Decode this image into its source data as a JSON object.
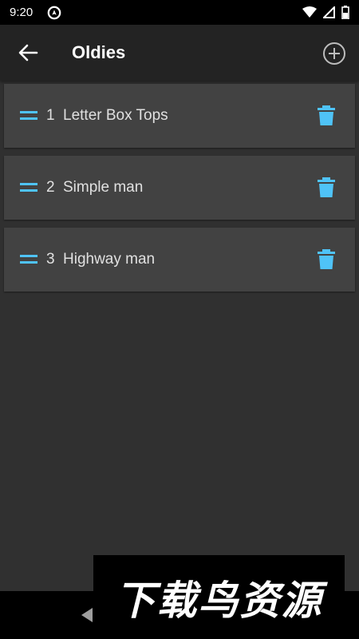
{
  "status_bar": {
    "time": "9:20",
    "icons": [
      "app-notification-icon",
      "wifi-icon",
      "cell-signal-icon",
      "battery-icon"
    ]
  },
  "app_bar": {
    "back_icon": "arrow-back-icon",
    "title": "Oldies",
    "add_icon": "add-circle-icon"
  },
  "songs": [
    {
      "number": "1",
      "name": "Letter Box Tops"
    },
    {
      "number": "2",
      "name": "Simple man"
    },
    {
      "number": "3",
      "name": "Highway man"
    }
  ],
  "colors": {
    "background": "#303030",
    "app_bar": "#232323",
    "card": "#424242",
    "accent": "#4fc3f7"
  },
  "watermark": {
    "text": "下载鸟资源"
  }
}
